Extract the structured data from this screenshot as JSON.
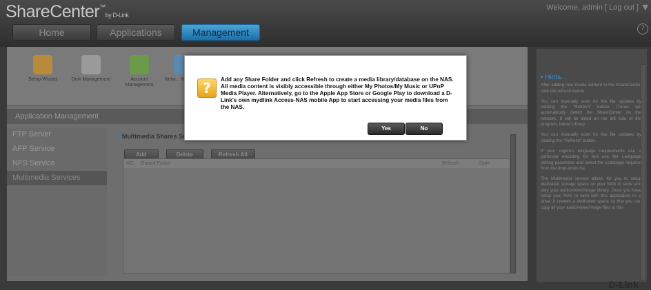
{
  "header": {
    "brand": "ShareCenter",
    "brand_tm": "™",
    "brand_by": "by D-Link",
    "welcome_text": "Welcome, admin [",
    "logout_label": "Log out",
    "welcome_close": "]",
    "welcome_arrow": "▼",
    "help_icon": "?"
  },
  "tabs": [
    {
      "label": "Home"
    },
    {
      "label": "Applications"
    },
    {
      "label": "Management"
    }
  ],
  "tools": [
    {
      "label": "Setup Wizard",
      "color": "#b98a3a"
    },
    {
      "label": "Disk Management",
      "color": "#9a9a9a"
    },
    {
      "label": "Account Management",
      "color": "#6a9a4a"
    },
    {
      "label": "Netw... Manage...",
      "color": "#5a8ab0"
    }
  ],
  "app_management_title": "Application Management",
  "nav": [
    {
      "label": "FTP Server"
    },
    {
      "label": "AFP Service"
    },
    {
      "label": "NFS Service"
    },
    {
      "label": "Multimedia Services"
    }
  ],
  "section_title": "Multimedia Shares Se",
  "buttons": {
    "add": "Add",
    "delete": "Delete",
    "refresh_all": "Refresh All"
  },
  "table_headers": {
    "no": "NO.",
    "shared_folder": "Shared Folder",
    "refresh": "Refresh",
    "state": "State"
  },
  "hints": {
    "title": "Hints...",
    "paragraphs": [
      "After adding new media content to the ShareCenter, click the refresh button.",
      "You can manually scan for the file updates by clicking the \"Refresh\" button. iTunes will automatically detect the ShareCenter on the network. It will be listed on the left side of the program, below Library.",
      "You can manually scan for the file updates by clicking the \"Refresh\" button.",
      "If your region's language requirements use a particular encoding for text use the Language setting parameter and select the codepage required from the drop-down list.",
      "The Multimedia service allows for you to setup dedicated storage space on your NAS to store and play your audio/video/image library. Once you have setup your NAS to work with this application on a drive, it creates a dedicated space so that you can copy all your audio/video/image files to this"
    ]
  },
  "footer_logo": "D-Link",
  "dialog": {
    "message": "Add any Share Folder and click Refresh to create a media library/database on the NAS. All media content is visibly accessible through either My Photos/My Music or UPnP Media Player. Alternatively, go to the Apple App Store or Google Play to download a D-Link's own mydlink Access-NAS mobile App to start accessing your media files from the NAS.",
    "icon": "?",
    "yes_label": "Yes",
    "no_label": "No"
  }
}
